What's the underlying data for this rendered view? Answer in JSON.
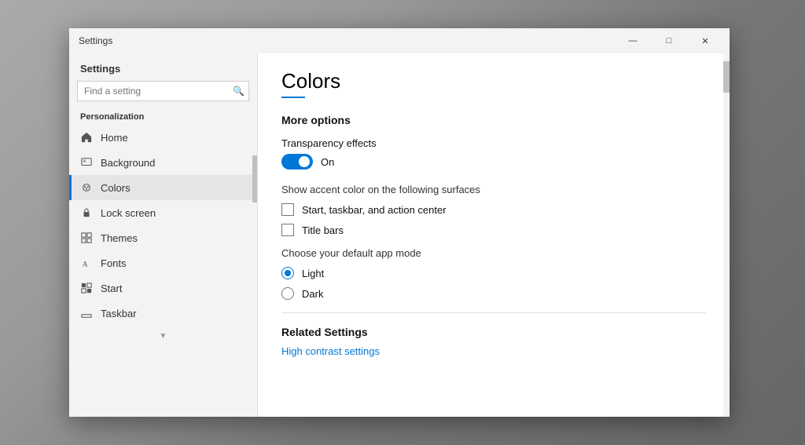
{
  "desktop": {
    "bg_color": "#888"
  },
  "window": {
    "title": "Settings",
    "controls": {
      "minimize": "—",
      "maximize": "□",
      "close": "✕"
    }
  },
  "sidebar": {
    "header": "Settings",
    "search_placeholder": "Find a setting",
    "section_label": "Personalization",
    "nav_items": [
      {
        "id": "home",
        "label": "Home",
        "icon": "home"
      },
      {
        "id": "background",
        "label": "Background",
        "icon": "background"
      },
      {
        "id": "colors",
        "label": "Colors",
        "icon": "colors",
        "active": true
      },
      {
        "id": "lock-screen",
        "label": "Lock screen",
        "icon": "lock"
      },
      {
        "id": "themes",
        "label": "Themes",
        "icon": "themes"
      },
      {
        "id": "fonts",
        "label": "Fonts",
        "icon": "fonts"
      },
      {
        "id": "start",
        "label": "Start",
        "icon": "start"
      },
      {
        "id": "taskbar",
        "label": "Taskbar",
        "icon": "taskbar"
      }
    ]
  },
  "main": {
    "page_title": "Colors",
    "sections": {
      "more_options": {
        "title": "More options",
        "transparency": {
          "label": "Transparency effects",
          "state": "On"
        },
        "accent_label": "Show accent color on the following surfaces",
        "checkboxes": [
          {
            "id": "taskbar",
            "label": "Start, taskbar, and action center",
            "checked": false
          },
          {
            "id": "titlebars",
            "label": "Title bars",
            "checked": false
          }
        ],
        "app_mode": {
          "label": "Choose your default app mode",
          "options": [
            {
              "id": "light",
              "label": "Light",
              "selected": true
            },
            {
              "id": "dark",
              "label": "Dark",
              "selected": false
            }
          ]
        }
      },
      "related": {
        "title": "Related Settings",
        "links": [
          {
            "id": "high-contrast",
            "label": "High contrast settings"
          }
        ]
      }
    }
  }
}
